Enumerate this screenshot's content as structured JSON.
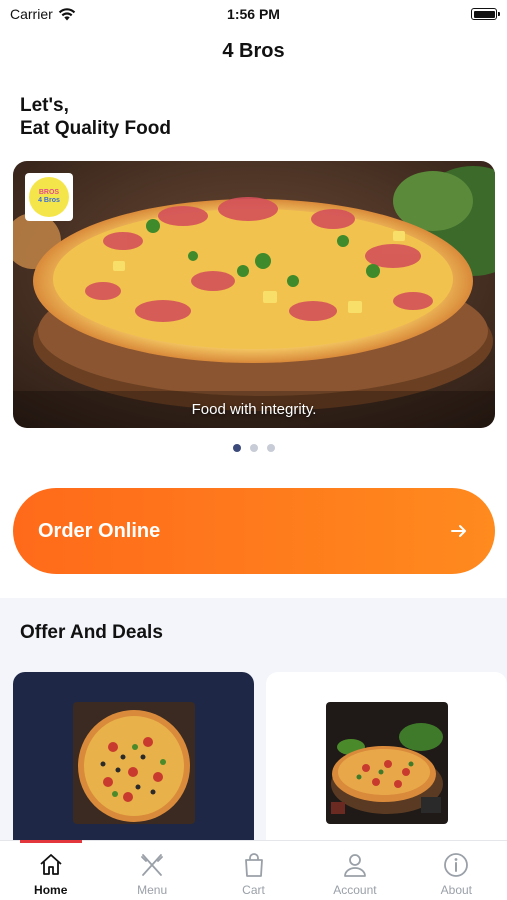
{
  "status": {
    "carrier": "Carrier",
    "time": "1:56 PM"
  },
  "nav": {
    "title": "4 Bros"
  },
  "greeting": {
    "line1": "Let's,",
    "line2": "Eat Quality Food"
  },
  "banner": {
    "caption": "Food with integrity.",
    "logo_text": "4 Bros",
    "logo_mark": "BROS",
    "active_slide": 1,
    "slide_count": 3
  },
  "order": {
    "label": "Order Online",
    "icon": "arrow-right-icon"
  },
  "offers": {
    "title": "Offer And Deals"
  },
  "tabs": [
    {
      "label": "Home",
      "icon": "home-icon",
      "active": true
    },
    {
      "label": "Menu",
      "icon": "utensils-icon",
      "active": false
    },
    {
      "label": "Cart",
      "icon": "shopping-bag-icon",
      "active": false
    },
    {
      "label": "Account",
      "icon": "user-icon",
      "active": false
    },
    {
      "label": "About",
      "icon": "info-icon",
      "active": false
    }
  ],
  "colors": {
    "accent": "#ff7a1c",
    "tab_indicator": "#e2363c",
    "dark_card": "#1e2846"
  }
}
